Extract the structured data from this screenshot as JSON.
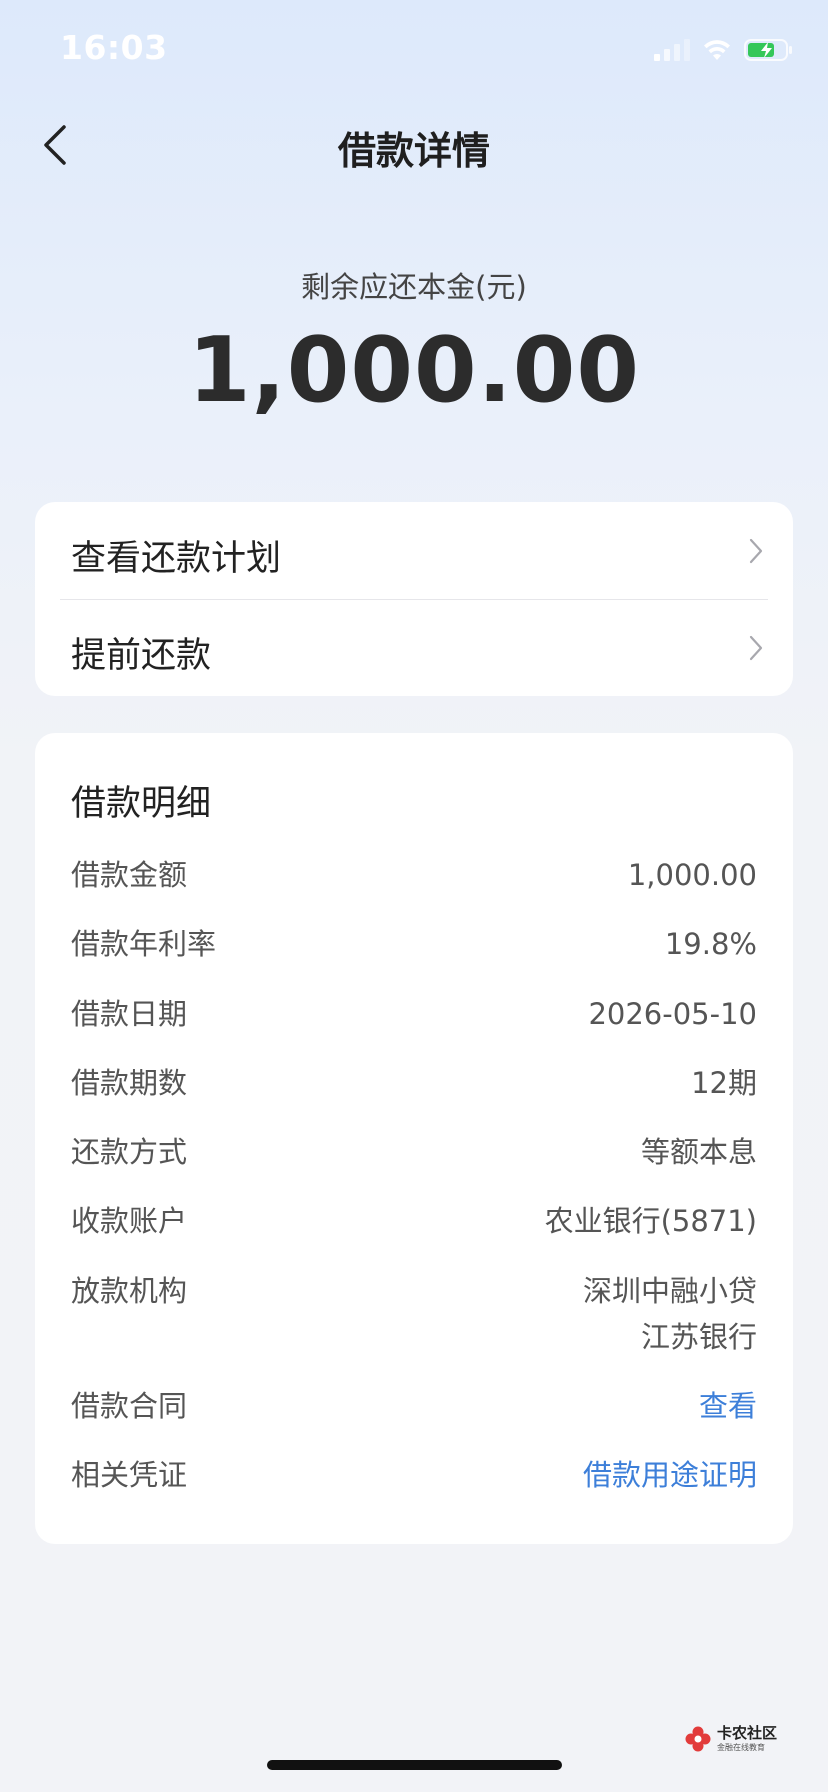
{
  "status_bar": {
    "time": "16:03"
  },
  "nav": {
    "title": "借款详情"
  },
  "summary": {
    "label": "剩余应还本金(元)",
    "amount": "1,000.00"
  },
  "actions": [
    {
      "label": "查看还款计划"
    },
    {
      "label": "提前还款"
    }
  ],
  "details": {
    "title": "借款明细",
    "rows": [
      {
        "label": "借款金额",
        "value": "1,000.00"
      },
      {
        "label": "借款年利率",
        "value": "19.8%"
      },
      {
        "label": "借款日期",
        "value": "2026-05-10"
      },
      {
        "label": "借款期数",
        "value": "12期"
      },
      {
        "label": "还款方式",
        "value": "等额本息"
      },
      {
        "label": "收款账户",
        "value": "农业银行(5871)"
      },
      {
        "label": "放款机构",
        "value": "深圳中融小贷",
        "value_line2": "江苏银行"
      },
      {
        "label": "借款合同",
        "value": "查看"
      },
      {
        "label": "相关凭证",
        "value": "借款用途证明"
      }
    ]
  },
  "watermark": {
    "name": "卡农社区",
    "sub": "金融在线教育"
  },
  "colors": {
    "link": "#3d7fd9",
    "battery": "#34c759"
  }
}
